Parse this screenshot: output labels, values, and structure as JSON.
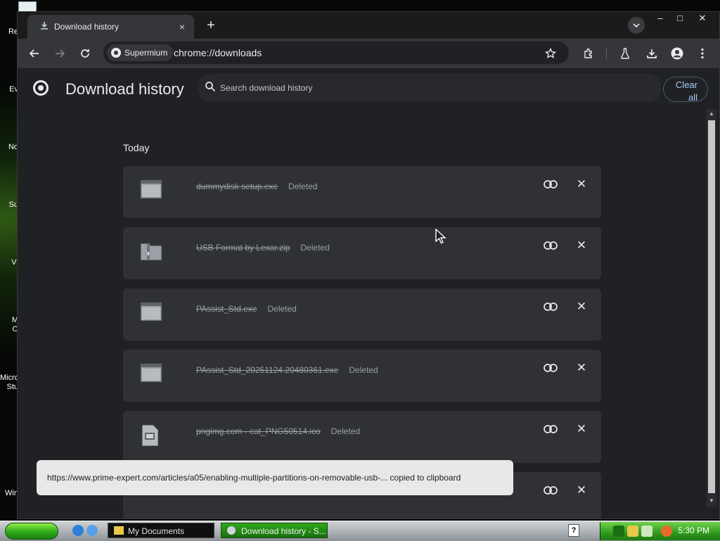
{
  "window": {
    "tab_title": "Download history",
    "tab_close": "×",
    "new_tab": "+",
    "controls": {
      "minimize": "–",
      "maximize": "□",
      "close": "✕"
    }
  },
  "toolbar": {
    "site_chip": "Supermium",
    "url": "chrome://downloads",
    "icons": [
      "back-icon",
      "forward-icon",
      "reload-icon",
      "bookmark-star-icon",
      "extensions-icon",
      "labs-icon",
      "downloads-icon",
      "profile-icon",
      "menu-icon"
    ]
  },
  "page": {
    "title": "Download history",
    "search_placeholder": "Search download history",
    "clear_all_line1": "Clear",
    "clear_all_line2": "all",
    "section_label": "Today",
    "items": [
      {
        "filename": "dummydisk setup.exe",
        "status": "Deleted",
        "icon": "app-window-icon"
      },
      {
        "filename": "USB Format by Lexar.zip",
        "status": "Deleted",
        "icon": "zip-folder-icon"
      },
      {
        "filename": "PAssist_Std.exe",
        "status": "Deleted",
        "icon": "app-window-icon"
      },
      {
        "filename": "PAssist_Std_20251124.20480361.exe",
        "status": "Deleted",
        "icon": "app-window-icon"
      },
      {
        "filename": "pngimg.com - cat_PNG50514.ico",
        "status": "Deleted",
        "icon": "image-file-icon"
      },
      {
        "filename": "",
        "status": "",
        "icon": ""
      }
    ],
    "toast": "https://www.prime-expert.com/articles/a05/enabling-multiple-partitions-on-removable-usb-... copied to clipboard"
  },
  "desktop": {
    "icon_labels": [
      "Re",
      "Ev",
      "No",
      "Su",
      "Vl",
      "M",
      "O",
      "Micro",
      "Stu",
      "Win"
    ]
  },
  "taskbar": {
    "tasks": [
      {
        "label": "My Documents",
        "active": false
      },
      {
        "label": "Download history - S...",
        "active": true
      }
    ],
    "clock": "5:30 PM",
    "help": "?"
  }
}
